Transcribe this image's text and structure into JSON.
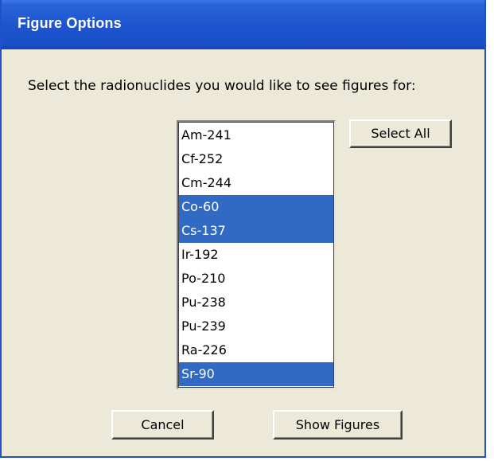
{
  "window": {
    "title": "Figure Options"
  },
  "prompt": "Select the radionuclides you would like to see figures for:",
  "listbox": {
    "items": [
      {
        "label": "Am-241",
        "selected": false
      },
      {
        "label": "Cf-252",
        "selected": false
      },
      {
        "label": "Cm-244",
        "selected": false
      },
      {
        "label": "Co-60",
        "selected": true
      },
      {
        "label": "Cs-137",
        "selected": true
      },
      {
        "label": "Ir-192",
        "selected": false
      },
      {
        "label": "Po-210",
        "selected": false
      },
      {
        "label": "Pu-238",
        "selected": false
      },
      {
        "label": "Pu-239",
        "selected": false
      },
      {
        "label": "Ra-226",
        "selected": false
      },
      {
        "label": "Sr-90",
        "selected": true
      }
    ]
  },
  "buttons": {
    "select_all": "Select All",
    "cancel": "Cancel",
    "show_figures": "Show Figures"
  },
  "colors": {
    "titlebar": "#1d55d0",
    "selection": "#316ac5",
    "dialog_bg": "#ece9d8"
  }
}
